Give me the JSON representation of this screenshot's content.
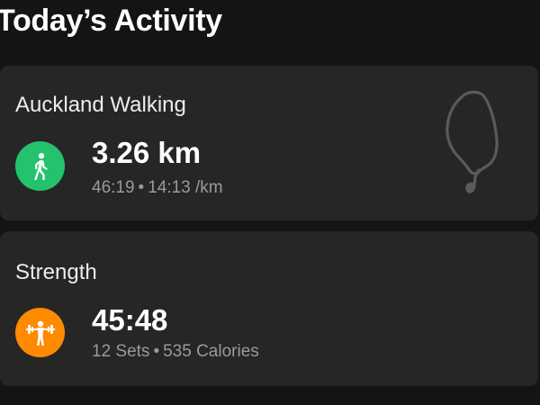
{
  "page": {
    "title": "Today’s Activity"
  },
  "activities": [
    {
      "name": "Auckland Walking",
      "icon": "walking-icon",
      "icon_color": "#25c26e",
      "metric": "3.26 km",
      "detail_a": "46:19",
      "detail_b": "14:13 /km",
      "separator": "•"
    },
    {
      "name": "Strength",
      "icon": "weightlifting-icon",
      "icon_color": "#ff8a00",
      "metric": "45:48",
      "detail_a": "12 Sets",
      "detail_b": "535 Calories",
      "separator": "•"
    }
  ],
  "colors": {
    "background": "#141414",
    "card": "#262626",
    "secondary_text": "#9a9a9a",
    "route_line": "#5a5a5a"
  }
}
